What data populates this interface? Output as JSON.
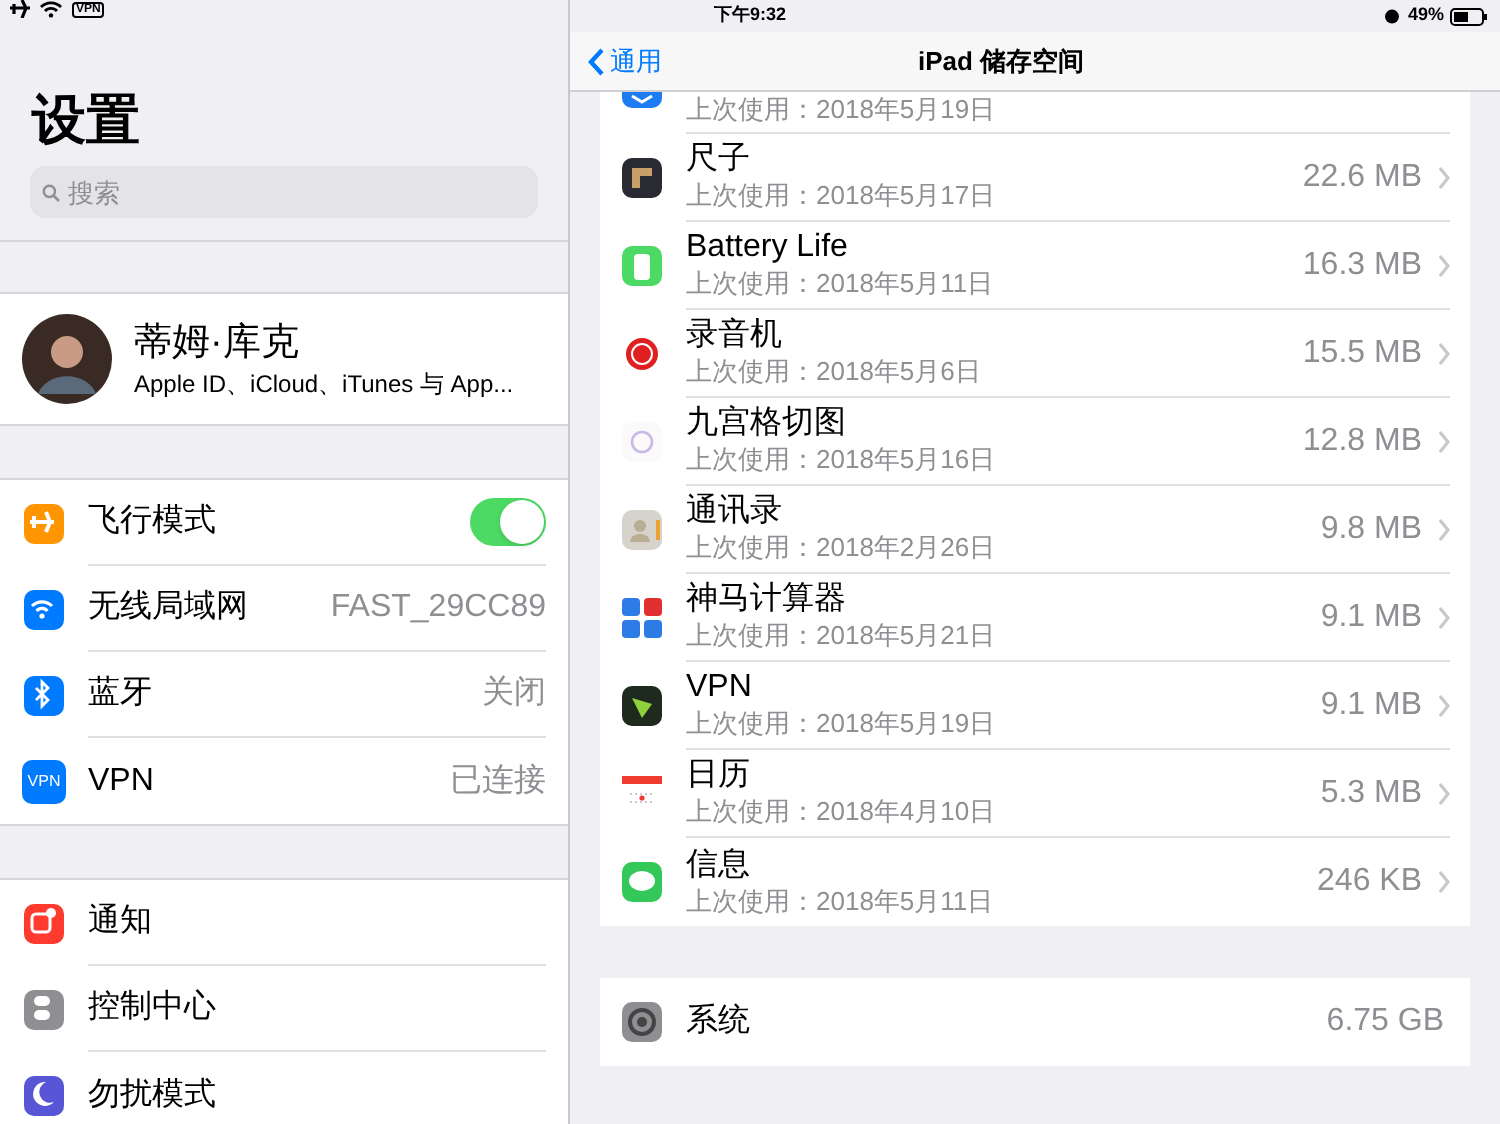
{
  "status_bar": {
    "vpn_badge": "VPN",
    "time": "下午9:32",
    "battery": "49%"
  },
  "sidebar": {
    "title": "设置",
    "search": {
      "placeholder": "搜索"
    },
    "profile": {
      "name": "蒂姆·库克",
      "subtitle": "Apple ID、iCloud、iTunes 与 App..."
    },
    "groups": [
      [
        {
          "kind": "toggle",
          "label": "飞行模式",
          "on": true
        },
        {
          "kind": "value",
          "label": "无线局域网",
          "value": "FAST_29CC89"
        },
        {
          "kind": "value",
          "label": "蓝牙",
          "value": "关闭"
        },
        {
          "kind": "value",
          "label": "VPN",
          "value": "已连接",
          "icon_text": "VPN"
        }
      ],
      [
        {
          "kind": "link",
          "label": "通知"
        },
        {
          "kind": "link",
          "label": "控制中心"
        },
        {
          "kind": "link",
          "label": "勿扰模式"
        }
      ]
    ]
  },
  "nav": {
    "back": "通用",
    "title": "iPad 储存空间"
  },
  "apps": [
    {
      "last_used": "上次使用：2018年5月19日"
    },
    {
      "name": "尺子",
      "last_used": "上次使用：2018年5月17日",
      "size": "22.6 MB"
    },
    {
      "name": "Battery Life",
      "last_used": "上次使用：2018年5月11日",
      "size": "16.3 MB"
    },
    {
      "name": "录音机",
      "last_used": "上次使用：2018年5月6日",
      "size": "15.5 MB"
    },
    {
      "name": "九宫格切图",
      "last_used": "上次使用：2018年5月16日",
      "size": "12.8 MB"
    },
    {
      "name": "通讯录",
      "last_used": "上次使用：2018年2月26日",
      "size": "9.8 MB"
    },
    {
      "name": "神马计算器",
      "last_used": "上次使用：2018年5月21日",
      "size": "9.1 MB"
    },
    {
      "name": "VPN",
      "last_used": "上次使用：2018年5月19日",
      "size": "9.1 MB"
    },
    {
      "name": "日历",
      "last_used": "上次使用：2018年4月10日",
      "size": "5.3 MB"
    },
    {
      "name": "信息",
      "last_used": "上次使用：2018年5月11日",
      "size": "246 KB"
    }
  ],
  "system": {
    "name": "系统",
    "size": "6.75 GB"
  }
}
